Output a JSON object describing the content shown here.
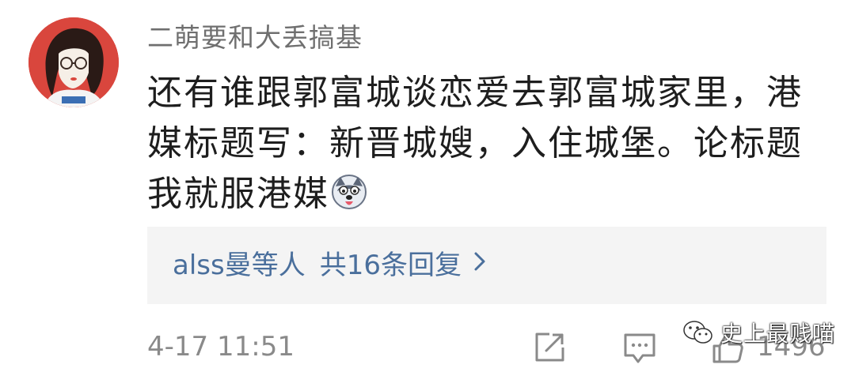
{
  "comment": {
    "username": "二萌要和大丢搞基",
    "text": "还有谁跟郭富城谈恋爱去郭富城家里，港媒标题写：新晋城嫂，入住城堡。论标题我就服港媒",
    "emoji_icon": "husky-dog-emoji"
  },
  "replies": {
    "preview_name": "alss曼等人",
    "count_label": "共16条回复",
    "chevron_icon": "chevron-right-icon"
  },
  "footer": {
    "timestamp": "4-17 11:51",
    "like_count": "1496",
    "share_icon": "share-icon",
    "comment_icon": "comment-icon",
    "like_icon": "thumbs-up-icon"
  },
  "watermark": {
    "text": "史上最贱喵",
    "logo_icon": "wechat-logo-icon"
  },
  "colors": {
    "username": "#6f6f6f",
    "body_text": "#1e1e1e",
    "reply_link": "#4a6f9c",
    "reply_bg": "#f4f4f4",
    "meta_gray": "#8a8a8a",
    "avatar_bg": "#d9463d"
  }
}
